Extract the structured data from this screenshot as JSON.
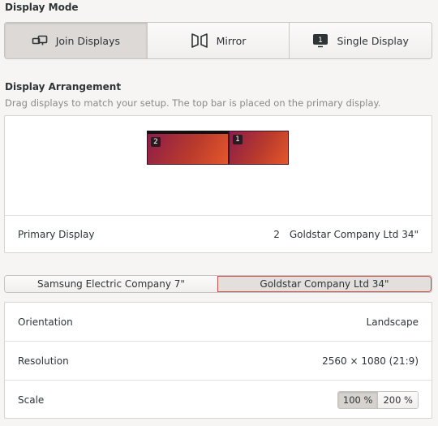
{
  "display_mode": {
    "title": "Display Mode",
    "options": [
      {
        "label": "Join Displays",
        "icon": "join-displays-icon",
        "active": true
      },
      {
        "label": "Mirror",
        "icon": "mirror-icon",
        "active": false
      },
      {
        "label": "Single Display",
        "icon": "single-display-icon",
        "active": false
      }
    ]
  },
  "arrangement": {
    "title": "Display Arrangement",
    "subtitle": "Drag displays to match your setup. The top bar is placed on the primary display.",
    "monitors": [
      {
        "number": "2",
        "primary": true
      },
      {
        "number": "1",
        "primary": false
      }
    ],
    "primary_display": {
      "label": "Primary Display",
      "number": "2",
      "name": "Goldstar Company Ltd 34\""
    }
  },
  "monitor_tabs": [
    {
      "label": "Samsung Electric Company 7\"",
      "active": false
    },
    {
      "label": "Goldstar Company Ltd 34\"",
      "active": true
    }
  ],
  "settings": {
    "orientation": {
      "label": "Orientation",
      "value": "Landscape"
    },
    "resolution": {
      "label": "Resolution",
      "value": "2560 × 1080 (21:9)"
    },
    "scale": {
      "label": "Scale",
      "options": [
        "100 %",
        "200 %"
      ],
      "selected": "100 %"
    }
  },
  "colors": {
    "accent_border": "#c9524a",
    "monitor_gradient_start": "#8b1d4a",
    "monitor_gradient_end": "#e4572a"
  }
}
